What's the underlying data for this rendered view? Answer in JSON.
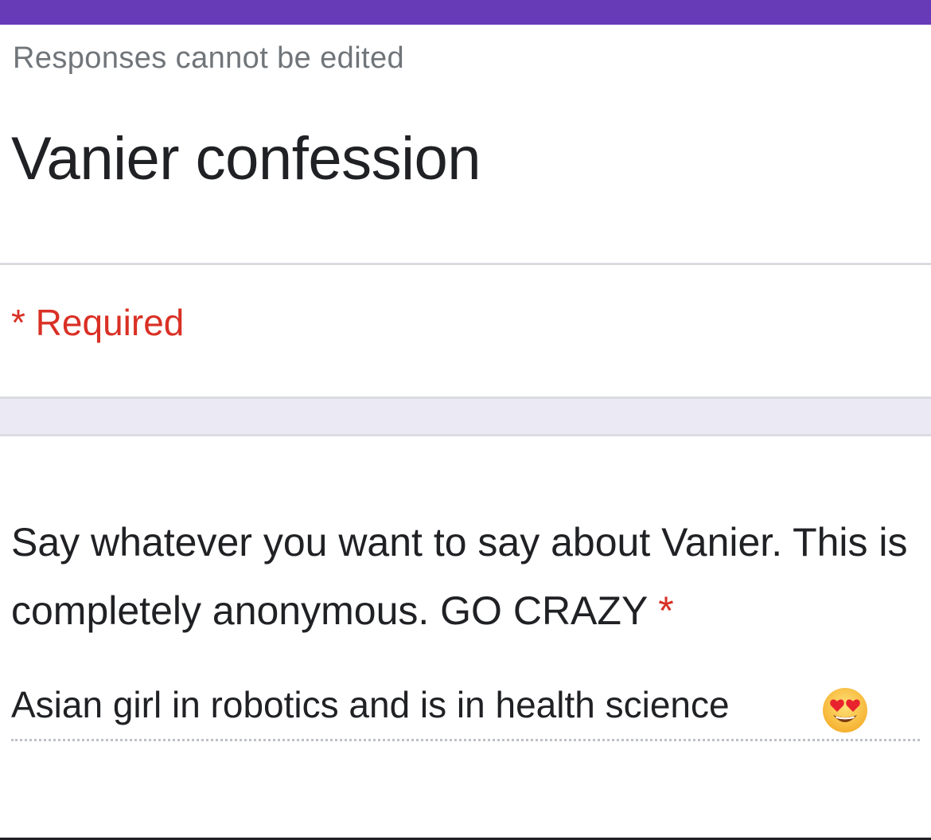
{
  "form": {
    "accent_color": "#673ab7",
    "notice": "Responses cannot be edited",
    "title": "Vanier confession",
    "required_note": "* Required"
  },
  "question": {
    "title": "Say whatever you want to say about Vanier. This is completely anonymous. GO CRAZY",
    "required_marker": "*",
    "answer": "Asian girl in robotics and is in health science",
    "answer_emoji": "smiling-face-with-heart-eyes-icon"
  }
}
